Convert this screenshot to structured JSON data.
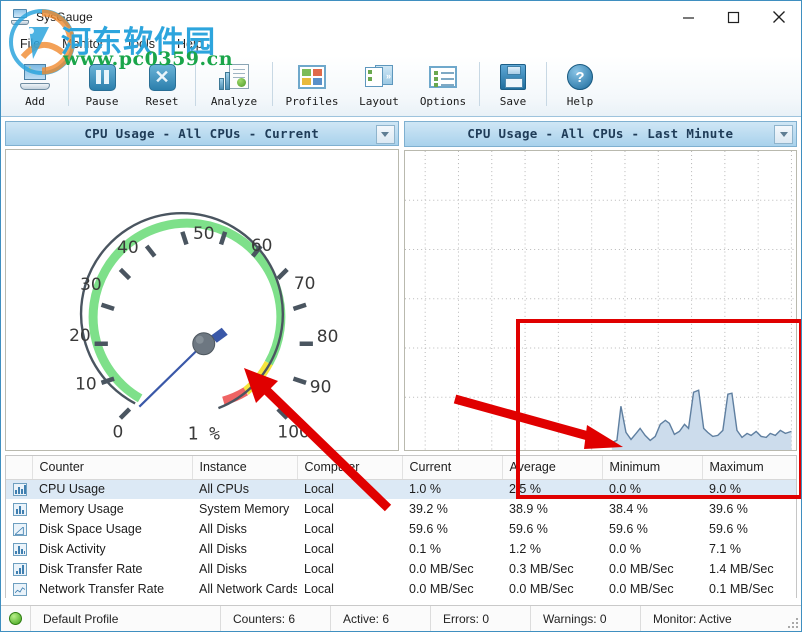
{
  "window": {
    "title": "SysGauge",
    "minimize_label": "Minimize",
    "maximize_label": "Maximize",
    "close_label": "Close"
  },
  "menu": {
    "items": [
      {
        "label": "File"
      },
      {
        "label": "Monitor"
      },
      {
        "label": "Tools"
      },
      {
        "label": "Help"
      }
    ]
  },
  "toolbar": {
    "buttons": [
      {
        "label": "Add",
        "icon": "add-monitor-icon"
      },
      {
        "label": "Pause",
        "icon": "pause-icon"
      },
      {
        "label": "Reset",
        "icon": "reset-icon"
      },
      {
        "label": "Analyze",
        "icon": "analyze-icon"
      },
      {
        "label": "Profiles",
        "icon": "profiles-icon"
      },
      {
        "label": "Layout",
        "icon": "layout-icon"
      },
      {
        "label": "Options",
        "icon": "options-icon"
      },
      {
        "label": "Save",
        "icon": "save-icon"
      },
      {
        "label": "Help",
        "icon": "help-icon"
      }
    ]
  },
  "panels": {
    "gauge": {
      "title": "CPU Usage - All CPUs - Current",
      "value_text": "1 %"
    },
    "chart": {
      "title": "CPU Usage - All CPUs - Last Minute"
    }
  },
  "chart_data": [
    {
      "type": "gauge",
      "title": "CPU Usage - All CPUs - Current",
      "value": 1,
      "unit": "%",
      "value_label": "1 %",
      "min": 0,
      "max": 100,
      "tick_labels": [
        "0",
        "10",
        "20",
        "30",
        "40",
        "50",
        "60",
        "70",
        "80",
        "90",
        "100"
      ],
      "zones": [
        {
          "from": 0,
          "to": 70,
          "color": "#7ee08a"
        },
        {
          "from": 70,
          "to": 88,
          "color": "#f5e53c"
        },
        {
          "from": 88,
          "to": 100,
          "color": "#ef6464"
        }
      ],
      "needle_color": "#3a58a8"
    },
    {
      "type": "area",
      "title": "CPU Usage - All CPUs - Last Minute",
      "xlabel": "",
      "ylabel": "",
      "ylim": [
        0,
        100
      ],
      "grid": true,
      "line_color": "#5f7fa0",
      "fill_color": "#ccdcec",
      "x": [
        0,
        1,
        2,
        3,
        4,
        5,
        6,
        7,
        8,
        9,
        10,
        11,
        12,
        13,
        14,
        15,
        16,
        17,
        18,
        19,
        20,
        21,
        22,
        23,
        24,
        25,
        26,
        27,
        28,
        29,
        30,
        31,
        32,
        33,
        34,
        35,
        36,
        37,
        38,
        39,
        40,
        41,
        42,
        43,
        44,
        45,
        46,
        47,
        48,
        49,
        50,
        51,
        52,
        53,
        54,
        55,
        56,
        57,
        58,
        59
      ],
      "values": [
        0,
        0,
        0,
        0,
        0,
        0,
        0,
        0,
        0,
        0,
        0,
        0,
        0,
        0,
        0,
        0,
        0,
        0,
        0,
        0,
        0,
        0,
        0,
        0,
        0,
        0,
        0,
        0,
        0,
        0,
        0,
        0,
        7,
        2,
        1,
        2,
        4,
        3,
        2,
        5,
        4,
        3,
        2,
        4,
        9,
        4,
        3,
        3,
        3,
        9,
        4,
        2,
        1,
        2,
        2,
        1,
        2,
        2,
        2,
        1
      ]
    }
  ],
  "table": {
    "columns": [
      "",
      "Counter",
      "Instance",
      "Computer",
      "Current",
      "Average",
      "Minimum",
      "Maximum"
    ],
    "rows": [
      {
        "icon": "line-chart-icon",
        "counter": "CPU Usage",
        "instance": "All CPUs",
        "computer": "Local",
        "current": "1.0 %",
        "average": "2.5 %",
        "minimum": "0.0 %",
        "maximum": "9.0 %",
        "selected": true
      },
      {
        "icon": "bar-chart-icon",
        "counter": "Memory Usage",
        "instance": "System Memory",
        "computer": "Local",
        "current": "39.2 %",
        "average": "38.9 %",
        "minimum": "38.4 %",
        "maximum": "39.6 %",
        "selected": false
      },
      {
        "icon": "area-chart-icon",
        "counter": "Disk Space Usage",
        "instance": "All Disks",
        "computer": "Local",
        "current": "59.6 %",
        "average": "59.6 %",
        "minimum": "59.6 %",
        "maximum": "59.6 %",
        "selected": false
      },
      {
        "icon": "histogram-icon",
        "counter": "Disk Activity",
        "instance": "All Disks",
        "computer": "Local",
        "current": "0.1 %",
        "average": "1.2 %",
        "minimum": "0.0 %",
        "maximum": "7.1 %",
        "selected": false
      },
      {
        "icon": "bar-rising-icon",
        "counter": "Disk Transfer Rate",
        "instance": "All Disks",
        "computer": "Local",
        "current": "0.0 MB/Sec",
        "average": "0.3 MB/Sec",
        "minimum": "0.0 MB/Sec",
        "maximum": "1.4 MB/Sec",
        "selected": false
      },
      {
        "icon": "line-chart-icon",
        "counter": "Network Transfer Rate",
        "instance": "All Network Cards",
        "computer": "Local",
        "current": "0.0 MB/Sec",
        "average": "0.0 MB/Sec",
        "minimum": "0.0 MB/Sec",
        "maximum": "0.1 MB/Sec",
        "selected": false
      }
    ]
  },
  "statusbar": {
    "profile": "Default Profile",
    "counters": "Counters: 6",
    "active": "Active: 6",
    "errors": "Errors: 0",
    "warnings": "Warnings: 0",
    "monitor": "Monitor: Active"
  },
  "watermark": {
    "chinese": "河东软件园",
    "url": "www.pc0359.cn"
  },
  "annotations": {
    "highlight_color": "#e00000"
  }
}
